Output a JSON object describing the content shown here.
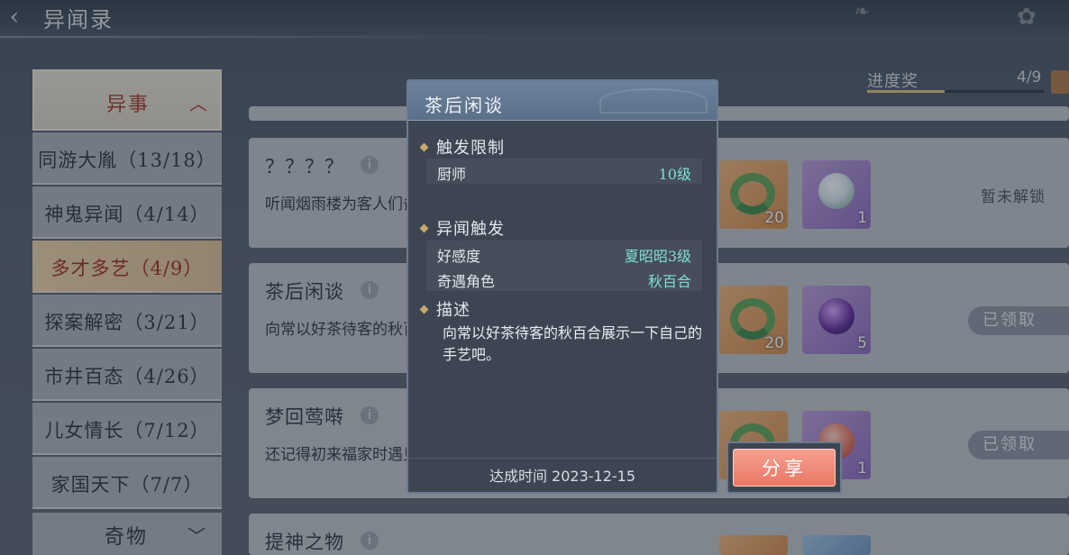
{
  "header": {
    "title": "异闻录"
  },
  "sidebar": {
    "category_top": "异事",
    "items": [
      {
        "label": "同游大胤（13/18）"
      },
      {
        "label": "神鬼异闻（4/14）"
      },
      {
        "label": "多才多艺（4/9）"
      },
      {
        "label": "探案解密（3/21）"
      },
      {
        "label": "市井百态（4/26）"
      },
      {
        "label": "儿女情长（7/12）"
      },
      {
        "label": "家国天下（7/7）"
      }
    ],
    "category_bottom": "奇物"
  },
  "progress": {
    "label": "进度奖",
    "count": "4/9",
    "fraction": 0.44
  },
  "cards": [
    {
      "name": "？？？？",
      "desc": "听闻烟雨楼为客人们备了稀奇杂耍之戏，以博玩乐。",
      "rewards": [
        {
          "kind": "snake",
          "count": "20"
        },
        {
          "kind": "orb",
          "count": "1"
        }
      ],
      "status": "暂未解锁"
    },
    {
      "name": "茶后闲谈",
      "desc": "向常以好茶待客的秋百合展示一下自己的手艺吧。",
      "rewards": [
        {
          "kind": "snake",
          "count": "20"
        },
        {
          "kind": "orb-dark",
          "count": "5"
        }
      ],
      "status": "已领取"
    },
    {
      "name": "梦回莺啭",
      "desc": "还记得初来福家时遇见的那位小姑娘。",
      "rewards": [
        {
          "kind": "snake",
          "count": ""
        },
        {
          "kind": "orb-red",
          "count": "1"
        }
      ],
      "status": "已领取"
    },
    {
      "name": "提神之物",
      "desc": "",
      "rewards": [],
      "status": ""
    }
  ],
  "popup": {
    "title": "茶后闲谈",
    "section1": "触发限制",
    "row1_key": "厨师",
    "row1_val": "10级",
    "section2": "异闻触发",
    "row2_key": "好感度",
    "row2_val": "夏昭昭3级",
    "row3_key": "奇遇角色",
    "row3_val": "秋百合",
    "section3": "描述",
    "desc": "向常以好茶待客的秋百合展示一下自己的手艺吧。",
    "time": "达成时间 2023-12-15"
  },
  "share": {
    "label": "分享"
  },
  "colors": {
    "accent_red": "#a13a28",
    "teal_value": "#7fe0cf",
    "share_btn": "#ea7866"
  }
}
